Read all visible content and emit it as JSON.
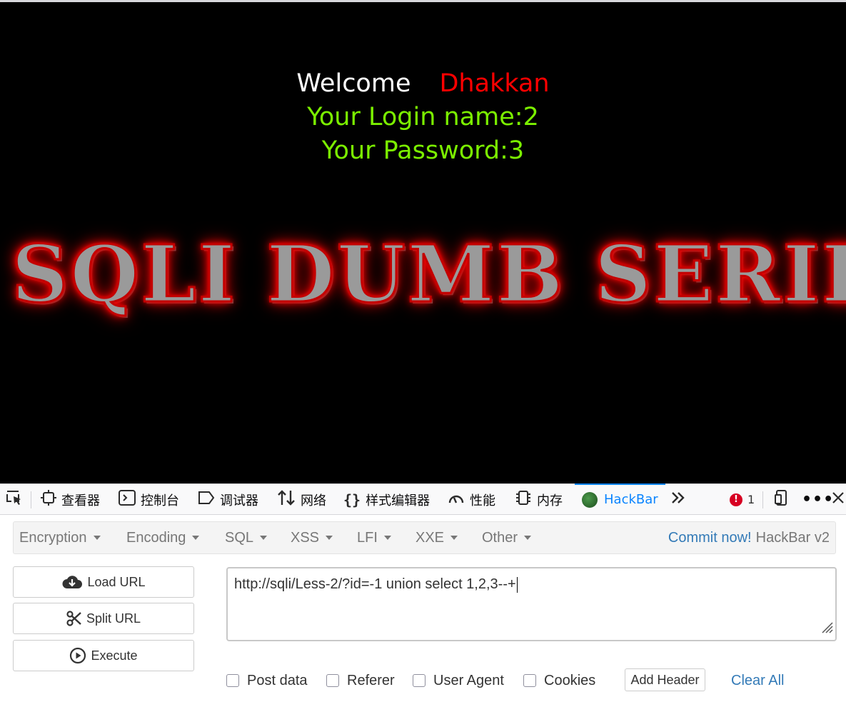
{
  "page": {
    "welcome_label": "Welcome",
    "welcome_name": "Dhakkan",
    "login_line": "Your Login name:2",
    "password_line": "Your Password:3",
    "banner_text": "SQLI DUMB SERIES"
  },
  "devtools": {
    "tabs": [
      {
        "label": "查看器",
        "icon": "inspector-icon"
      },
      {
        "label": "控制台",
        "icon": "console-icon"
      },
      {
        "label": "调试器",
        "icon": "debugger-icon"
      },
      {
        "label": "网络",
        "icon": "network-icon"
      },
      {
        "label": "样式编辑器",
        "icon": "style-editor-icon"
      },
      {
        "label": "性能",
        "icon": "performance-icon"
      },
      {
        "label": "内存",
        "icon": "memory-icon"
      },
      {
        "label": "HackBar",
        "icon": "hackbar-icon",
        "active": true
      }
    ],
    "error_count": "1"
  },
  "hackbar": {
    "menu": [
      "Encryption",
      "Encoding",
      "SQL",
      "XSS",
      "LFI",
      "XXE",
      "Other"
    ],
    "commit_link": "Commit now!",
    "version": "HackBar v2",
    "buttons": {
      "load_url": "Load URL",
      "split_url": "Split URL",
      "execute": "Execute"
    },
    "url_value": "http://sqli/Less-2/?id=-1 union select 1,2,3--+",
    "options": [
      "Post data",
      "Referer",
      "User Agent",
      "Cookies"
    ],
    "add_header": "Add Header",
    "clear_all": "Clear All"
  },
  "colors": {
    "accent": "#0a84ff",
    "link": "#337ab7",
    "welcome_name": "#ff0000",
    "login_text": "#7bf000",
    "error": "#d70022"
  }
}
